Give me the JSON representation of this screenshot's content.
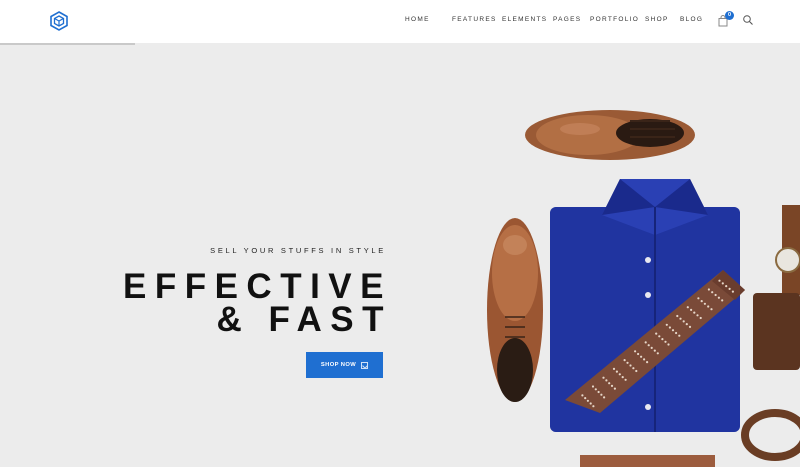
{
  "header": {
    "nav": [
      {
        "label": "HOME"
      },
      {
        "label": "FEATURES"
      },
      {
        "label": "ELEMENTS"
      },
      {
        "label": "PAGES"
      },
      {
        "label": "PORTFOLIO"
      },
      {
        "label": "SHOP"
      },
      {
        "label": "BLOG"
      }
    ],
    "cart_count": "0",
    "icons": {
      "logo": "hexagon-cube-logo",
      "cart": "shopping-bag-icon",
      "search": "search-icon"
    }
  },
  "hero": {
    "tagline": "SELL YOUR STUFFS IN STYLE",
    "headline_line1": "EFFECTIVE",
    "headline_line2": "& FAST",
    "button_label": "SHOP NOW",
    "button_icon": "arrow-box-icon"
  },
  "colors": {
    "accent": "#1f6fd1",
    "background": "#ececec",
    "header": "#ffffff",
    "text": "#111111"
  }
}
